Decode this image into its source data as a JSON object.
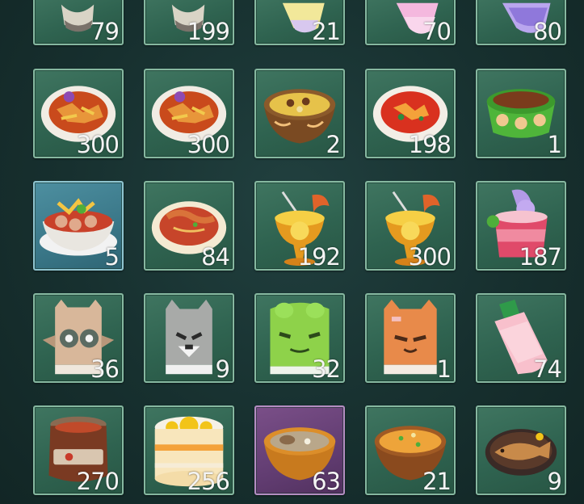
{
  "inventory": {
    "row1": [
      {
        "count": "79",
        "item": "pudding-cup-icon"
      },
      {
        "count": "199",
        "item": "pudding-cup-icon"
      },
      {
        "count": "21",
        "item": "yellow-drink-icon"
      },
      {
        "count": "70",
        "item": "pink-drink-icon"
      },
      {
        "count": "80",
        "item": "purple-drink-icon"
      }
    ],
    "row2": [
      {
        "count": "300",
        "item": "stir-fry-plate-icon"
      },
      {
        "count": "300",
        "item": "stir-fry-plate-icon"
      },
      {
        "count": "2",
        "item": "curry-bowl-icon"
      },
      {
        "count": "198",
        "item": "tomato-egg-plate-icon"
      },
      {
        "count": "1",
        "item": "pet-food-bowl-icon"
      }
    ],
    "row3": [
      {
        "count": "5",
        "item": "meatball-soup-icon"
      },
      {
        "count": "84",
        "item": "shrimp-noodle-plate-icon"
      },
      {
        "count": "192",
        "item": "shrimp-cocktail-icon"
      },
      {
        "count": "300",
        "item": "shrimp-cocktail-icon"
      },
      {
        "count": "187",
        "item": "berry-parfait-icon"
      }
    ],
    "row4": [
      {
        "count": "36",
        "item": "owl-box-toy-icon"
      },
      {
        "count": "9",
        "item": "wolf-box-toy-icon"
      },
      {
        "count": "32",
        "item": "frog-box-toy-icon"
      },
      {
        "count": "1",
        "item": "fox-box-toy-icon"
      },
      {
        "count": "74",
        "item": "strawberry-milk-icon"
      }
    ],
    "row5": [
      {
        "count": "270",
        "item": "jam-jar-icon"
      },
      {
        "count": "256",
        "item": "orange-cake-icon"
      },
      {
        "count": "63",
        "item": "mushroom-stew-icon"
      },
      {
        "count": "21",
        "item": "egg-drop-soup-icon"
      },
      {
        "count": "9",
        "item": "grilled-fish-plate-icon"
      }
    ]
  },
  "colors": {
    "slot_green": "#2f6350",
    "slot_blue": "#3a7788",
    "slot_purple": "#623d72",
    "background": "#17302f",
    "count_text": "#f4f4f4"
  }
}
